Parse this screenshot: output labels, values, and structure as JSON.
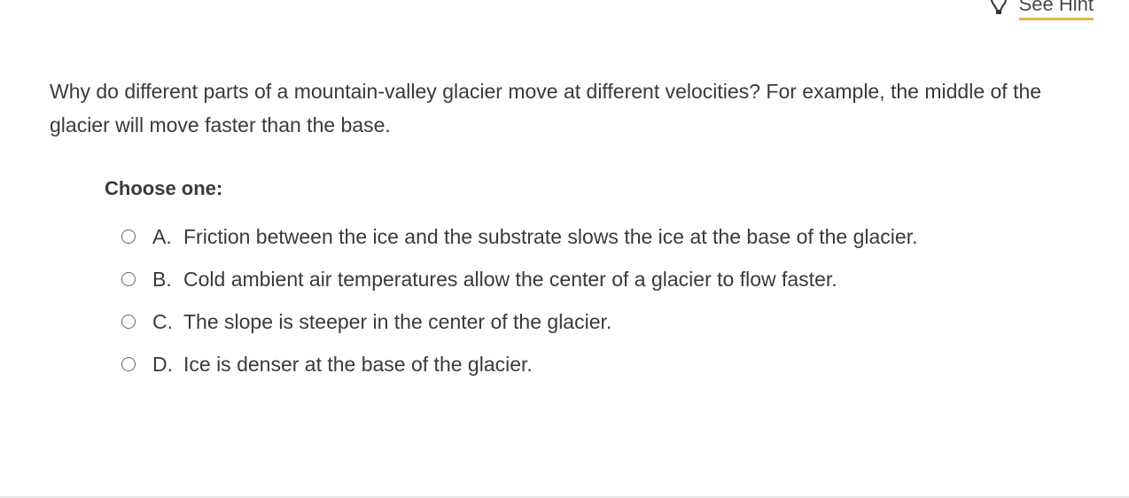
{
  "hint": {
    "icon": "lightbulb-icon",
    "label": "See Hint",
    "underline_color": "#e0b34a"
  },
  "question": {
    "text": "Why do different parts of a mountain-valley glacier move at different velocities? For example, the middle of the glacier will move faster than the base."
  },
  "choices": {
    "prompt": "Choose one:",
    "options": [
      {
        "letter": "A.",
        "text": "Friction between the ice and the substrate slows the ice at the base of the glacier.",
        "selected": false
      },
      {
        "letter": "B.",
        "text": "Cold ambient air temperatures allow the center of a glacier to flow faster.",
        "selected": false
      },
      {
        "letter": "C.",
        "text": "The slope is steeper in the center of the glacier.",
        "selected": false
      },
      {
        "letter": "D.",
        "text": "Ice is denser at the base of the glacier.",
        "selected": false
      }
    ]
  }
}
